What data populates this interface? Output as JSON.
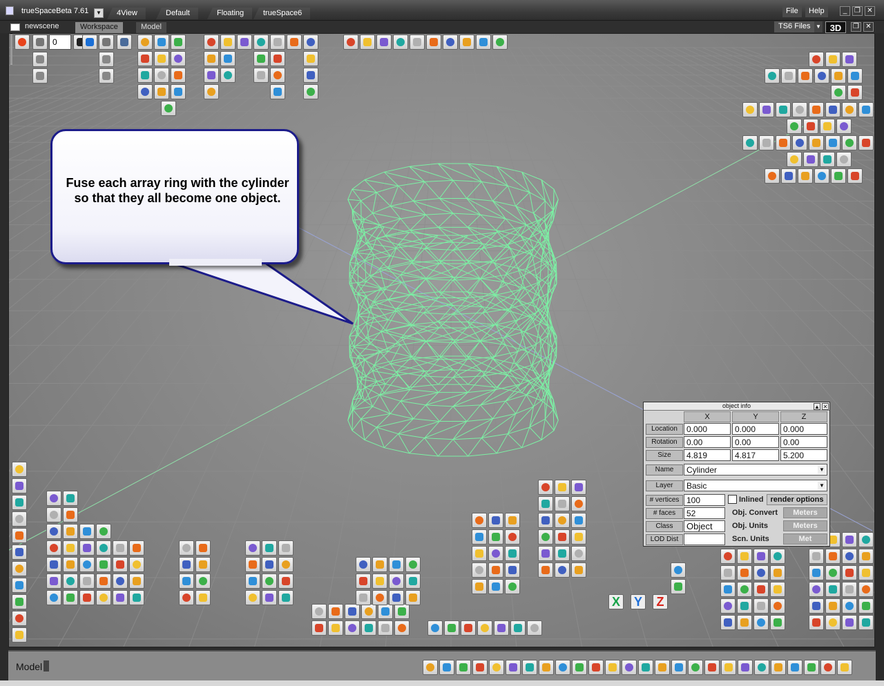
{
  "app": {
    "title": "trueSpaceBeta 7.61",
    "layouts": [
      "4View",
      "Default",
      "Floating",
      "trueSpace6"
    ],
    "menu": {
      "file": "File",
      "help": "Help"
    },
    "window_buttons": {
      "minimize": "_",
      "restore": "❐",
      "close": "✕"
    }
  },
  "tabs": {
    "scene": "newscene",
    "workspace": "Workspace",
    "model": "Model",
    "files": "TS6 Files",
    "view_mode": "3D"
  },
  "animation": {
    "frame_value": "0"
  },
  "callout": {
    "text": "Fuse each array ring with the cylinder so that they all become one object."
  },
  "object_info": {
    "title": "object info",
    "columns": [
      "X",
      "Y",
      "Z"
    ],
    "location_label": "Location",
    "location": [
      "0.000",
      "0.000",
      "0.000"
    ],
    "rotation_label": "Rotation",
    "rotation": [
      "0.00",
      "0.00",
      "0.00"
    ],
    "size_label": "Size",
    "size": [
      "4.819",
      "4.817",
      "5.200"
    ],
    "name_label": "Name",
    "name": "Cylinder",
    "layer_label": "Layer",
    "layer": "Basic",
    "vertices_label": "# vertices",
    "vertices": "100",
    "faces_label": "# faces",
    "faces": "52",
    "class_label": "Class",
    "class": "Object",
    "lod_label": "LOD Dist",
    "lod": "",
    "inlined_label": "Inlined",
    "render_options": "render options",
    "obj_convert_label": "Obj. Convert",
    "obj_convert": "Meters",
    "obj_units_label": "Obj. Units",
    "obj_units": "Meters",
    "scn_units_label": "Scn. Units",
    "scn_units": "Met"
  },
  "status": {
    "mode": "Model"
  },
  "colors": {
    "wireframe": "#7cf0a4",
    "grid": "#8d8d8d",
    "callout_border": "#1c1c8a"
  },
  "toolbar_icons": {
    "xyz_x": "X",
    "xyz_y": "Y",
    "xyz_z": "Z",
    "nav": {
      "rec": "record-icon",
      "first": "first-frame-icon",
      "play": "play-icon",
      "last": "last-frame-icon"
    }
  }
}
